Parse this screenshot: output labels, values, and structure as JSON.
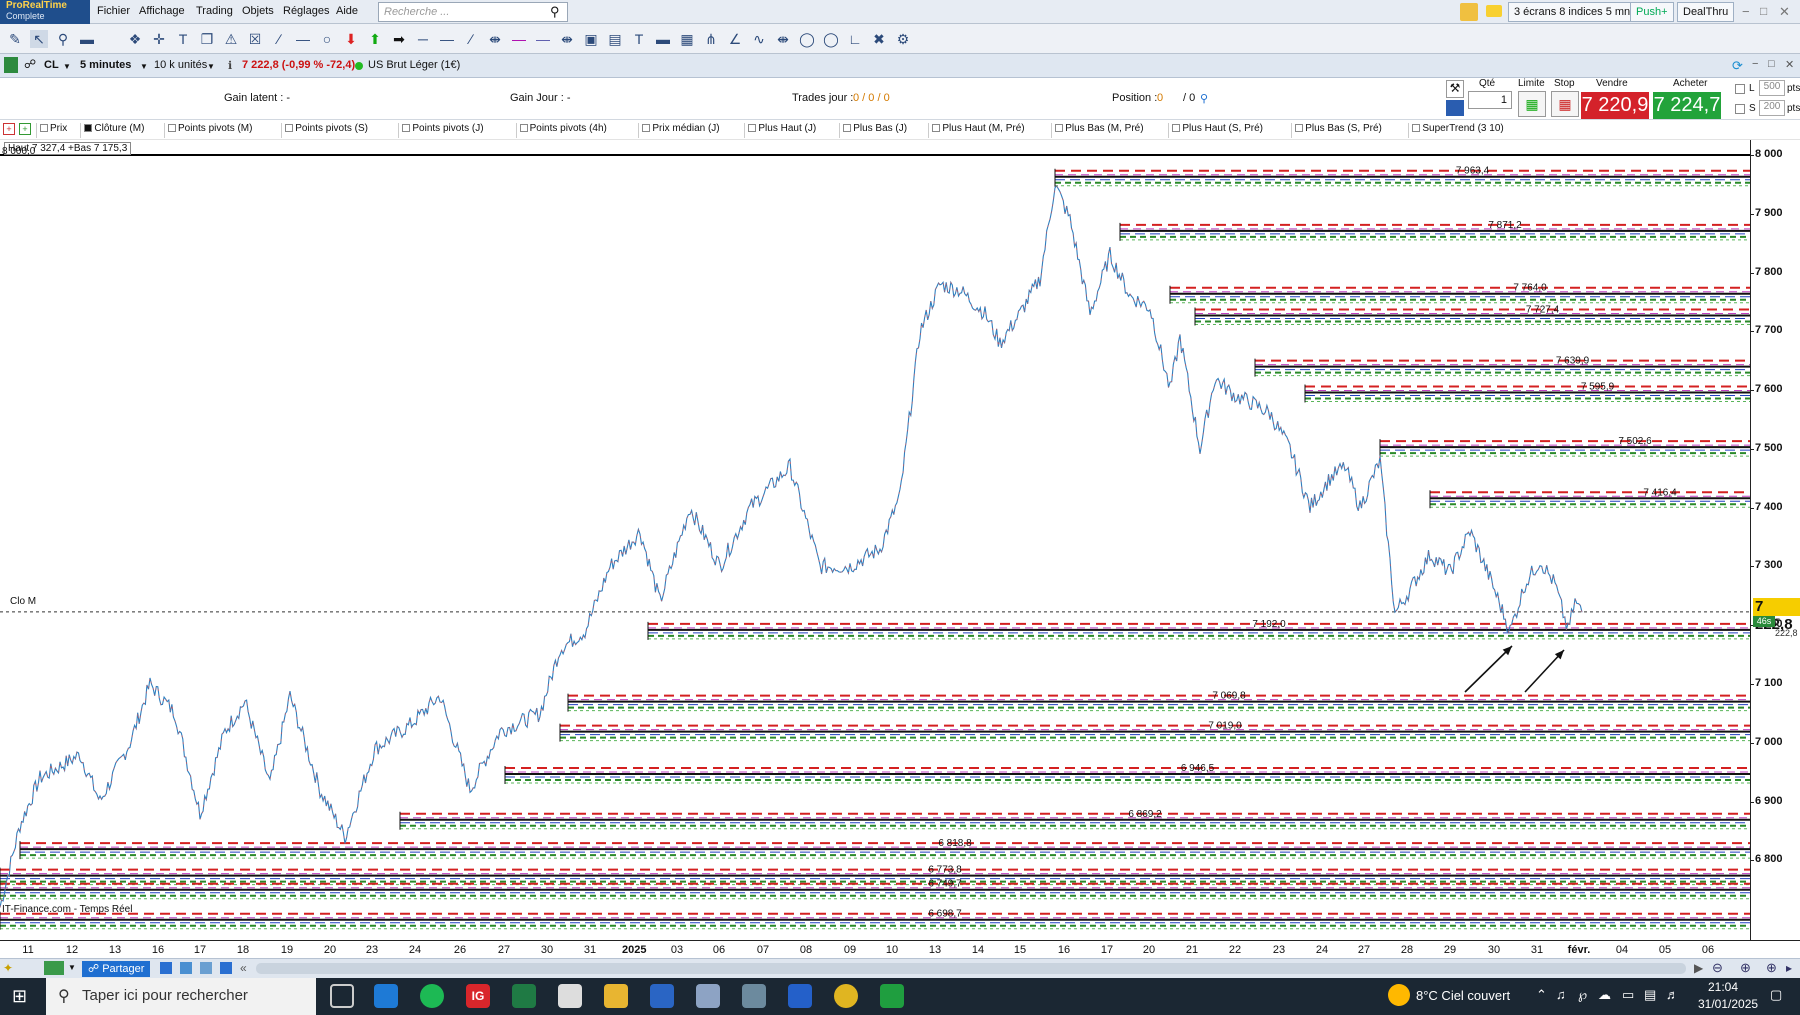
{
  "app": {
    "logo_line1": "ProRealTime",
    "logo_line2": "Complete"
  },
  "menu": [
    "Fichier",
    "Affichage",
    "Trading",
    "Objets",
    "Réglages",
    "Aide"
  ],
  "search": {
    "placeholder": "Recherche ..."
  },
  "top_right": {
    "layout_label": "3 écrans 8 indices 5 mn",
    "push_label": "Push+",
    "dealthru_label": "DealThru"
  },
  "chart_header": {
    "symbol": "CL",
    "timeframe": "5 minutes",
    "units": "10 k unités",
    "quote": "7 222,8 (-0,99 % -72,4)",
    "instrument": "US Brut Léger (1€)"
  },
  "trade_panel": {
    "gain_latent": "Gain latent : -",
    "gain_jour": "Gain Jour : -",
    "trades_jour_label": "Trades jour :",
    "trades_jour_value": "0 / 0 / 0",
    "position_label": "Position :",
    "position_value": "0",
    "position_value2": "/ 0",
    "qty_label": "Qté",
    "qty_value": "1",
    "limit_label": "Limite",
    "stop_label": "Stop",
    "sell_label": "Vendre",
    "buy_label": "Acheter",
    "sell_price": "7 220,9",
    "buy_price": "7 224,7",
    "l_label": "L",
    "s_label": "S",
    "l_value": "500",
    "s_value": "200",
    "pts": "pts"
  },
  "indicators": [
    "Prix",
    "Clôture (M)",
    "Points pivots (M)",
    "Points pivots (S)",
    "Points pivots (J)",
    "Points pivots (4h)",
    "Prix médian (J)",
    "Plus Haut (J)",
    "Plus Bas (J)",
    "Plus Haut (M, Pré)",
    "Plus Bas (M, Pré)",
    "Plus Haut (S, Pré)",
    "Plus Bas (S, Pré)",
    "SuperTrend (3 10)"
  ],
  "chart_overlay": {
    "hilo": "Haut 7 327,4 +Bas 7 175,3",
    "top_value": "8 000,0",
    "clo_m": "Clo M",
    "source": "IT-Finance.com - Temps Réel",
    "last_price": "7 222,8",
    "last_price_small": "7 222,8",
    "countdown": "46s",
    "level_labels": [
      "7 963,4",
      "7 871,2",
      "7 764,0",
      "7 727,4",
      "7 639,9",
      "7 595,9",
      "7 502,6",
      "7 416,4",
      "7 192,0",
      "7 069,8",
      "7 019,0",
      "6 946,5",
      "6 869,2",
      "6 818,8",
      "6 773,8",
      "6 749,7",
      "6 698,7"
    ]
  },
  "chart_data": {
    "type": "candlestick-line",
    "symbol": "CL",
    "ylim": [
      6690,
      8000
    ],
    "y_ticks": [
      "8 000",
      "7 900",
      "7 800",
      "7 700",
      "7 600",
      "7 500",
      "7 400",
      "7 300",
      "7 200",
      "7 100",
      "7 000",
      "6 900",
      "6 800"
    ],
    "x_ticks": [
      "11",
      "12",
      "13",
      "16",
      "17",
      "18",
      "19",
      "20",
      "23",
      "24",
      "26",
      "27",
      "30",
      "31",
      "2025",
      "03",
      "06",
      "07",
      "08",
      "09",
      "10",
      "13",
      "14",
      "15",
      "16",
      "17",
      "20",
      "21",
      "22",
      "23",
      "24",
      "27",
      "28",
      "29",
      "30",
      "31",
      "févr.",
      "04",
      "05",
      "06"
    ],
    "price_path": [
      [
        0,
        6720
      ],
      [
        20,
        6860
      ],
      [
        40,
        6940
      ],
      [
        60,
        6960
      ],
      [
        80,
        6980
      ],
      [
        100,
        6900
      ],
      [
        130,
        7000
      ],
      [
        150,
        7100
      ],
      [
        175,
        7050
      ],
      [
        200,
        6880
      ],
      [
        225,
        7020
      ],
      [
        245,
        7070
      ],
      [
        270,
        6930
      ],
      [
        290,
        7080
      ],
      [
        320,
        6920
      ],
      [
        345,
        6840
      ],
      [
        375,
        6990
      ],
      [
        410,
        7030
      ],
      [
        440,
        7080
      ],
      [
        470,
        6920
      ],
      [
        500,
        7020
      ],
      [
        540,
        7050
      ],
      [
        560,
        7160
      ],
      [
        585,
        7190
      ],
      [
        610,
        7300
      ],
      [
        640,
        7360
      ],
      [
        660,
        7240
      ],
      [
        690,
        7400
      ],
      [
        720,
        7300
      ],
      [
        750,
        7400
      ],
      [
        790,
        7470
      ],
      [
        820,
        7300
      ],
      [
        850,
        7300
      ],
      [
        880,
        7330
      ],
      [
        900,
        7420
      ],
      [
        920,
        7700
      ],
      [
        940,
        7780
      ],
      [
        960,
        7770
      ],
      [
        985,
        7730
      ],
      [
        1000,
        7680
      ],
      [
        1020,
        7730
      ],
      [
        1040,
        7790
      ],
      [
        1055,
        7950
      ],
      [
        1070,
        7890
      ],
      [
        1090,
        7730
      ],
      [
        1110,
        7830
      ],
      [
        1130,
        7760
      ],
      [
        1150,
        7740
      ],
      [
        1170,
        7600
      ],
      [
        1180,
        7690
      ],
      [
        1200,
        7500
      ],
      [
        1215,
        7620
      ],
      [
        1235,
        7590
      ],
      [
        1250,
        7580
      ],
      [
        1270,
        7560
      ],
      [
        1290,
        7500
      ],
      [
        1310,
        7400
      ],
      [
        1330,
        7450
      ],
      [
        1345,
        7470
      ],
      [
        1360,
        7400
      ],
      [
        1380,
        7480
      ],
      [
        1395,
        7220
      ],
      [
        1410,
        7260
      ],
      [
        1430,
        7320
      ],
      [
        1450,
        7290
      ],
      [
        1470,
        7360
      ],
      [
        1490,
        7280
      ],
      [
        1510,
        7190
      ],
      [
        1525,
        7270
      ],
      [
        1540,
        7310
      ],
      [
        1555,
        7270
      ],
      [
        1568,
        7190
      ],
      [
        1575,
        7240
      ],
      [
        1582,
        7222
      ]
    ],
    "levels": [
      {
        "start": 1055,
        "y": 7963
      },
      {
        "start": 1120,
        "y": 7871
      },
      {
        "start": 1170,
        "y": 7764
      },
      {
        "start": 1195,
        "y": 7727
      },
      {
        "start": 1255,
        "y": 7640
      },
      {
        "start": 1305,
        "y": 7596
      },
      {
        "start": 1380,
        "y": 7503
      },
      {
        "start": 1430,
        "y": 7416
      },
      {
        "start": 648,
        "y": 7192
      },
      {
        "start": 568,
        "y": 7070
      },
      {
        "start": 560,
        "y": 7019
      },
      {
        "start": 505,
        "y": 6947
      },
      {
        "start": 400,
        "y": 6869
      },
      {
        "start": 20,
        "y": 6819
      },
      {
        "start": 0,
        "y": 6774
      },
      {
        "start": 0,
        "y": 6750
      },
      {
        "start": 0,
        "y": 6699
      }
    ]
  },
  "taskbar": {
    "search_placeholder": "Taper ici pour rechercher",
    "weather": "8°C  Ciel couvert",
    "time": "21:04",
    "date": "31/01/2025"
  },
  "share_label": "Partager"
}
